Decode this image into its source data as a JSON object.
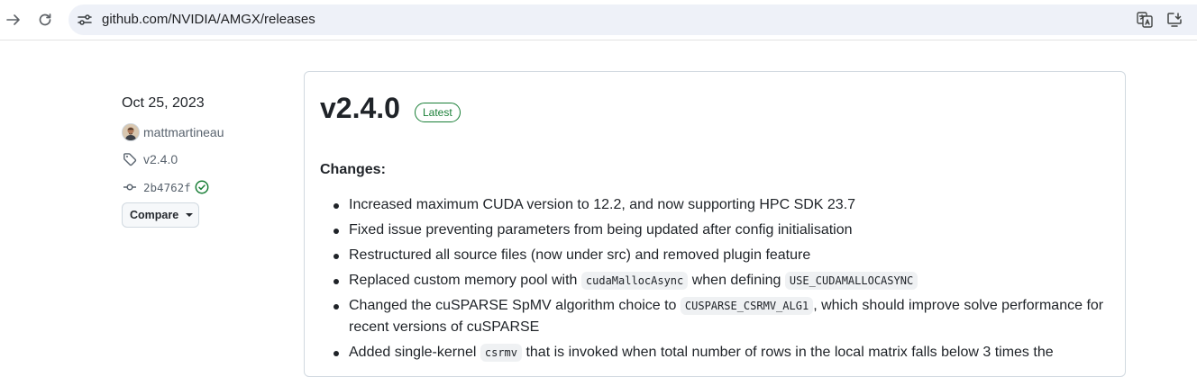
{
  "browser": {
    "url": "github.com/NVIDIA/AMGX/releases"
  },
  "release": {
    "date": "Oct 25, 2023",
    "author": "mattmartineau",
    "tag": "v2.4.0",
    "commit": "2b4762f",
    "compare_label": "Compare",
    "title": "v2.4.0",
    "badge": "Latest",
    "changes_heading": "Changes:",
    "changes": [
      {
        "text": "Increased maximum CUDA version to 12.2, and now supporting HPC SDK 23.7"
      },
      {
        "text": "Fixed issue preventing parameters from being updated after config initialisation"
      },
      {
        "text": "Restructured all source files (now under src) and removed plugin feature"
      },
      {
        "pre": "Replaced custom memory pool with ",
        "code1": "cudaMallocAsync",
        "mid": " when defining ",
        "code2": "USE_CUDAMALLOCASYNC"
      },
      {
        "pre": "Changed the cuSPARSE SpMV algorithm choice to ",
        "code1": "CUSPARSE_CSRMV_ALG1",
        "post": ", which should improve solve performance for recent versions of cuSPARSE"
      },
      {
        "pre": "Added single-kernel ",
        "code1": "csrmv",
        "post": " that is invoked when total number of rows in the local matrix falls below 3 times the"
      }
    ]
  },
  "colors": {
    "accent_green": "#1a7f37",
    "muted_text": "#59636e",
    "border": "#d1d9e0"
  }
}
